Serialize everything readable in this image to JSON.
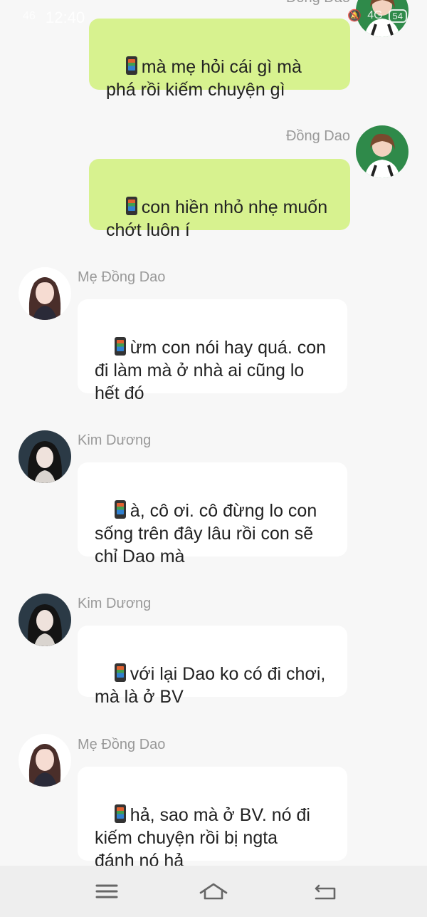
{
  "status_bar": {
    "signal": "46",
    "time": "12:40",
    "network": "4G",
    "battery": "54"
  },
  "messages": [
    {
      "sender": "Đồng Dao",
      "side": "right",
      "avatar": "dong-dao",
      "text": "mà mẹ hỏi cái gì mà\nphá rồi kiếm chuyện gì"
    },
    {
      "sender": "Đồng Dao",
      "side": "right",
      "avatar": "dong-dao",
      "text": "con hiền nhỏ nhẹ muốn\nchớt luôn í"
    },
    {
      "sender": "Mẹ Đồng Dao",
      "side": "left",
      "avatar": "me-dong-dao",
      "text": "ừm con nói hay quá. con\nđi làm mà ở nhà ai cũng lo\nhết đó"
    },
    {
      "sender": "Kim Dương",
      "side": "left",
      "avatar": "kim-duong",
      "text": "à, cô ơi. cô đừng lo con\nsống trên đây lâu rồi con sẽ\nchỉ Dao mà"
    },
    {
      "sender": "Kim Dương",
      "side": "left",
      "avatar": "kim-duong",
      "text": "với lại Dao ko có đi chơi,\nmà là ở BV"
    },
    {
      "sender": "Mẹ Đồng Dao",
      "side": "left",
      "avatar": "me-dong-dao",
      "text": "hả, sao mà ở BV. nó đi\nkiếm chuyện rồi bị ngta\nđánh nó hả"
    }
  ],
  "navbar": {
    "menu_icon": "menu-icon",
    "home_icon": "home-icon",
    "back_icon": "back-icon"
  },
  "colors": {
    "mine_bubble": "#d7f28f",
    "their_bubble": "#ffffff",
    "background": "#f7f7f7",
    "name_text": "#999999"
  }
}
